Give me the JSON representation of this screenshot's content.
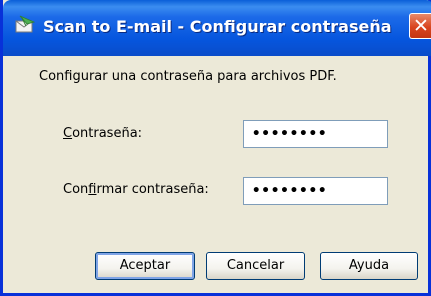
{
  "window": {
    "title": "Scan to E-mail - Configurar contraseña",
    "close_glyph": "✕"
  },
  "dialog": {
    "instruction": "Configurar una contraseña para archivos PDF.",
    "password_label_accel": "C",
    "password_label_rest": "ontraseña:",
    "password_value": "••••••••",
    "confirm_label_pre": "Con",
    "confirm_label_accel": "f",
    "confirm_label_rest": "irmar contraseña:",
    "confirm_value": "••••••••"
  },
  "buttons": {
    "ok": "Aceptar",
    "cancel": "Cancelar",
    "help": "Ayuda"
  },
  "colors": {
    "titlebar": "#0656de",
    "face": "#ece9d8",
    "close": "#d9451f"
  }
}
